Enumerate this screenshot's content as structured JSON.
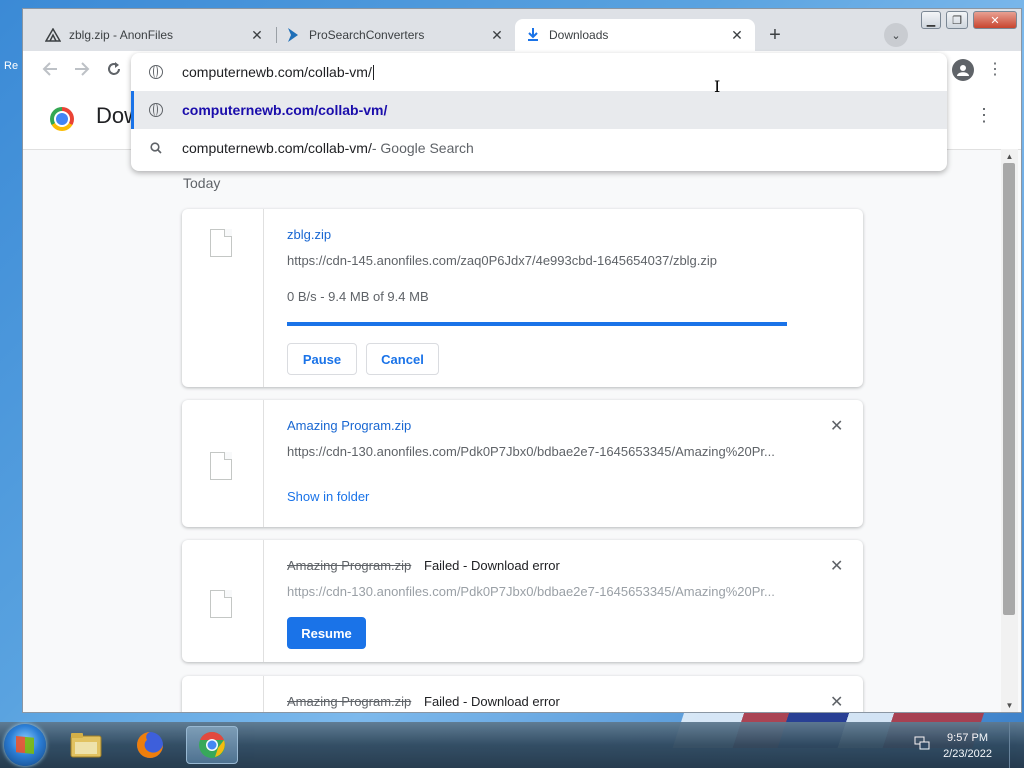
{
  "desktop": {
    "side_text": "Re"
  },
  "tabs": [
    {
      "title": "zblg.zip - AnonFiles",
      "icon": "anonfiles-icon",
      "active": false
    },
    {
      "title": "ProSearchConverters",
      "icon": "prosearch-icon",
      "active": false
    },
    {
      "title": "Downloads",
      "icon": "download-icon",
      "active": true
    }
  ],
  "toolbar": {
    "omnibox_value": "computernewb.com/collab-vm/",
    "suggestions": [
      {
        "text": "computernewb.com/collab-vm/",
        "suffix": "",
        "icon": "globe-icon"
      },
      {
        "text": "computernewb.com/collab-vm/",
        "suffix": " - Google Search",
        "icon": "search-icon"
      }
    ]
  },
  "page": {
    "title": "Downloads",
    "section": "Today",
    "downloads": [
      {
        "filename": "zblg.zip",
        "url": "https://cdn-145.anonfiles.com/zaq0P6Jdx7/4e993cbd-1645654037/zblg.zip",
        "progress_text": "0 B/s - 9.4 MB of 9.4 MB",
        "progress": 1.0,
        "pause_label": "Pause",
        "cancel_label": "Cancel"
      },
      {
        "filename": "Amazing Program.zip",
        "url": "https://cdn-130.anonfiles.com/Pdk0P7Jbx0/bdbae2e7-1645653345/Amazing%20Pr...",
        "action_label": "Show in folder"
      },
      {
        "filename": "Amazing Program.zip",
        "status": "Failed - Download error",
        "url": "https://cdn-130.anonfiles.com/Pdk0P7Jbx0/bdbae2e7-1645653345/Amazing%20Pr...",
        "resume_label": "Resume"
      },
      {
        "filename": "Amazing Program.zip",
        "status": "Failed - Download error"
      }
    ]
  },
  "taskbar": {
    "time": "9:57 PM",
    "date": "2/23/2022",
    "apps": [
      "explorer-icon",
      "firefox-icon",
      "chrome-icon"
    ]
  },
  "colors": {
    "accent": "#1a73e8",
    "link": "#1967d2"
  }
}
